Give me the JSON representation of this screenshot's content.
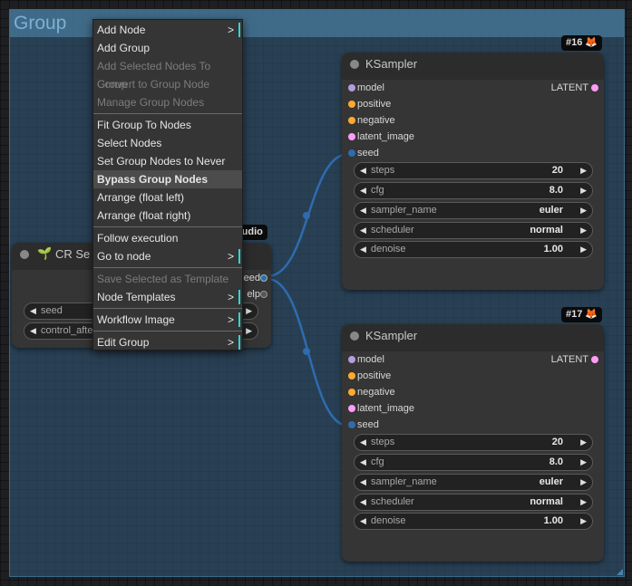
{
  "group": {
    "title": "Group"
  },
  "colors": {
    "canvas": "#1e1f22",
    "group_fill": "#305673",
    "group_header": "#48799a",
    "link": "#2e6bb0",
    "slot_model": "#b39ddb",
    "slot_conditioning": "#ffa931",
    "slot_latent": "#ff9cf9",
    "slot_int": "#2e6bb0",
    "menu_accent": "#2bd7d7"
  },
  "context_menu": {
    "items": [
      {
        "label": "Add Node",
        "submenu": ">",
        "enabled": true
      },
      {
        "label": "Add Group",
        "enabled": true
      },
      {
        "label": "Add Selected Nodes To Group",
        "enabled": false
      },
      {
        "label": "Convert to Group Node",
        "enabled": false
      },
      {
        "label": "Manage Group Nodes",
        "enabled": false
      },
      {
        "label": "Fit Group To Nodes",
        "enabled": true
      },
      {
        "label": "Select Nodes",
        "enabled": true
      },
      {
        "label": "Set Group Nodes to Never",
        "enabled": true
      },
      {
        "label": "Bypass Group Nodes",
        "enabled": true,
        "highlighted": true
      },
      {
        "label": "Arrange (float left)",
        "enabled": true
      },
      {
        "label": "Arrange (float right)",
        "enabled": true
      },
      {
        "label": "Follow execution",
        "enabled": true
      },
      {
        "label": "Go to node",
        "submenu": ">",
        "enabled": true
      },
      {
        "label": "Save Selected as Template",
        "enabled": false
      },
      {
        "label": "Node Templates",
        "submenu": ">",
        "enabled": true
      },
      {
        "label": "Workflow Image",
        "submenu": ">",
        "enabled": true
      },
      {
        "label": "Edit Group",
        "submenu": ">",
        "enabled": true
      }
    ]
  },
  "cr_seed_node": {
    "title_partial": "CR Se",
    "badge_partial": "tudio",
    "outputs": [
      "eed",
      "elp"
    ],
    "widgets": [
      {
        "name": "seed"
      },
      {
        "name": "control_after"
      }
    ]
  },
  "ksampler_nodes": [
    {
      "badge_id": "#16",
      "title": "KSampler",
      "inputs": [
        "model",
        "positive",
        "negative",
        "latent_image",
        "seed"
      ],
      "output": "LATENT",
      "widgets": [
        {
          "name": "steps",
          "value": "20"
        },
        {
          "name": "cfg",
          "value": "8.0"
        },
        {
          "name": "sampler_name",
          "value": "euler"
        },
        {
          "name": "scheduler",
          "value": "normal"
        },
        {
          "name": "denoise",
          "value": "1.00"
        }
      ]
    },
    {
      "badge_id": "#17",
      "title": "KSampler",
      "inputs": [
        "model",
        "positive",
        "negative",
        "latent_image",
        "seed"
      ],
      "output": "LATENT",
      "widgets": [
        {
          "name": "steps",
          "value": "20"
        },
        {
          "name": "cfg",
          "value": "8.0"
        },
        {
          "name": "sampler_name",
          "value": "euler"
        },
        {
          "name": "scheduler",
          "value": "normal"
        },
        {
          "name": "denoise",
          "value": "1.00"
        }
      ]
    }
  ],
  "icons": {
    "fox": "fox-icon",
    "arrow_left": "◀",
    "arrow_right": "▶",
    "seedling": "seedling-icon"
  }
}
